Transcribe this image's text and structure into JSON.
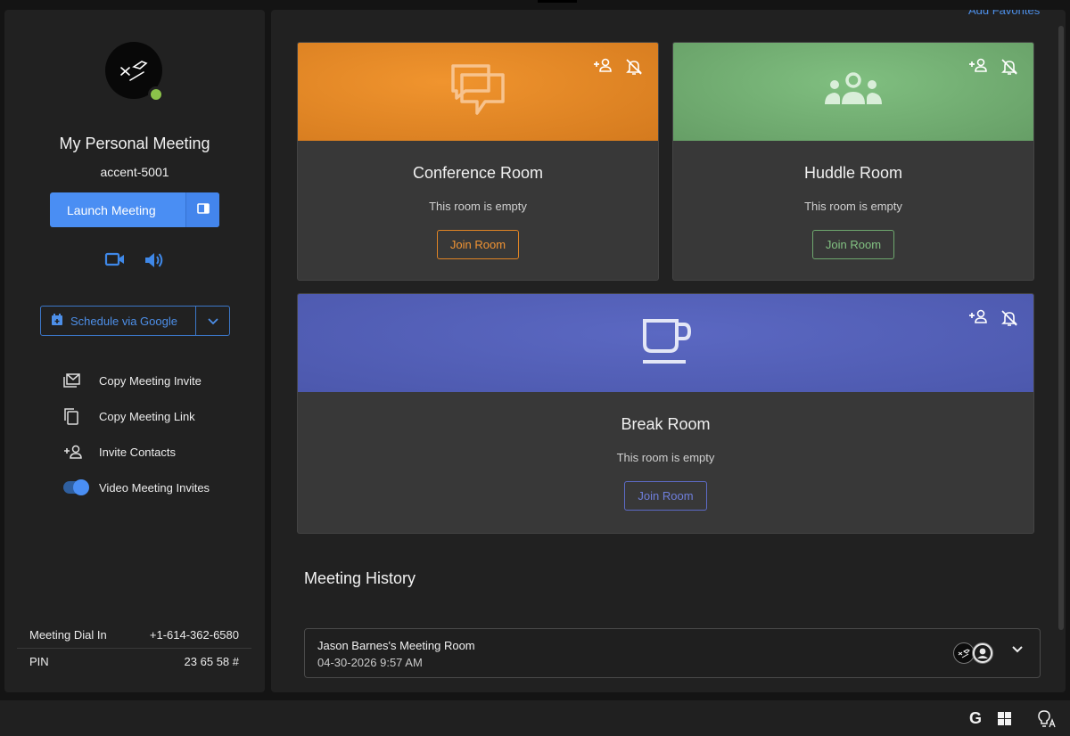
{
  "sidebar": {
    "avatar_icon": "user-logo-avatar",
    "status_color": "#8bc34a",
    "meeting_title": "My Personal Meeting",
    "meeting_id": "accent-5001",
    "launch_label": "Launch Meeting",
    "schedule_label": "Schedule via Google",
    "actions": [
      {
        "label": "Copy Meeting Invite",
        "icon": "mail-icon"
      },
      {
        "label": "Copy Meeting Link",
        "icon": "copy-icon"
      },
      {
        "label": "Invite Contacts",
        "icon": "add-person-icon"
      },
      {
        "label": "Video Meeting Invites",
        "icon": "toggle-switch",
        "toggled": true
      }
    ],
    "dial_in_label": "Meeting Dial In",
    "dial_in_value": "+1-614-362-6580",
    "pin_label": "PIN",
    "pin_value": "23 65 58 #"
  },
  "main": {
    "add_favorites": "Add Favorites",
    "rooms": [
      {
        "name": "Conference Room",
        "status": "This room is empty",
        "join_label": "Join Room",
        "icon": "chat-bubbles-icon",
        "color": "#e4861f"
      },
      {
        "name": "Huddle Room",
        "status": "This room is empty",
        "join_label": "Join Room",
        "icon": "group-icon",
        "color": "#75ae75"
      },
      {
        "name": "Break Room",
        "status": "This room is empty",
        "join_label": "Join Room",
        "icon": "coffee-cup-icon",
        "color": "#5460b8"
      }
    ],
    "history_title": "Meeting History",
    "history": [
      {
        "name": "Jason Barnes's Meeting Room",
        "date": "04-30-2026 9:57 AM"
      }
    ]
  },
  "taskbar": {
    "g_label": "G",
    "icons": [
      "g-icon",
      "windows-icon",
      "lightbulb-translate-icon"
    ]
  },
  "colors": {
    "accent": "#4a8ef3",
    "panel": "#212121",
    "card": "#383838"
  }
}
